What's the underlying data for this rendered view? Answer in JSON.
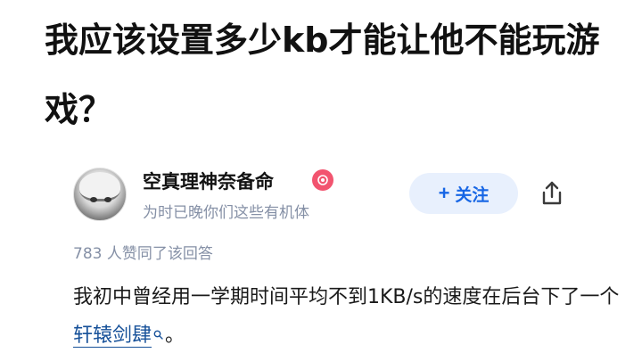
{
  "question": {
    "title": "我应该设置多少kb才能让他不能玩游戏？"
  },
  "answer": {
    "author": {
      "name": "空真理神奈备命",
      "bio": "为时已晚你们这些有机体"
    },
    "follow_label": "关注",
    "follow_prefix": "+",
    "vote_text": "783 人赞同了该回答",
    "content": {
      "text_before": "我初中曾经用一学期时间平均不到1KB/s的速度在后台下了一个",
      "link_text": "轩辕剑肆",
      "text_after": "。"
    }
  },
  "icons": {
    "badge": "medal-badge-icon",
    "share": "share-icon",
    "search": "search-icon"
  },
  "colors": {
    "follow_bg": "#e8f0fd",
    "follow_text": "#1766e5",
    "secondary_text": "#8590a6",
    "link": "#175199",
    "badge": "#f2546f"
  }
}
